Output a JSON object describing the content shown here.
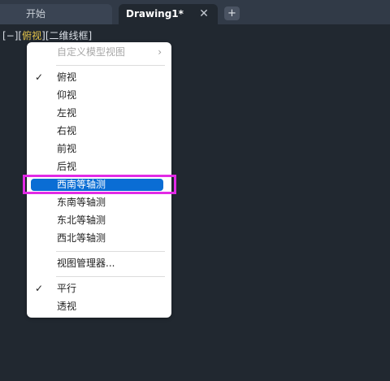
{
  "tabs": {
    "start_label": "开始",
    "drawing_label": "Drawing1*",
    "close_glyph": "✕",
    "new_tab_glyph": "+"
  },
  "viewport_controls": {
    "minus": "[−]",
    "view_open": "[",
    "view": "俯视",
    "view_close": "]",
    "style": "[二维线框]"
  },
  "menu": {
    "custom_model_views": "自定义模型视图",
    "submenu_arrow": "›",
    "check_glyph": "✓",
    "views": [
      "俯视",
      "仰视",
      "左视",
      "右视",
      "前视",
      "后视",
      "西南等轴测",
      "东南等轴测",
      "东北等轴测",
      "西北等轴测"
    ],
    "checked_view": "俯视",
    "highlighted_view": "西南等轴测",
    "view_manager": "视图管理器...",
    "projection": [
      "平行",
      "透视"
    ],
    "checked_projection": "平行"
  },
  "colors": {
    "background": "#212830",
    "tab_bar": "#313a47",
    "view_label": "#e2c24a",
    "highlight": "#0a6dd4",
    "focus_outline": "#e22ae6"
  }
}
